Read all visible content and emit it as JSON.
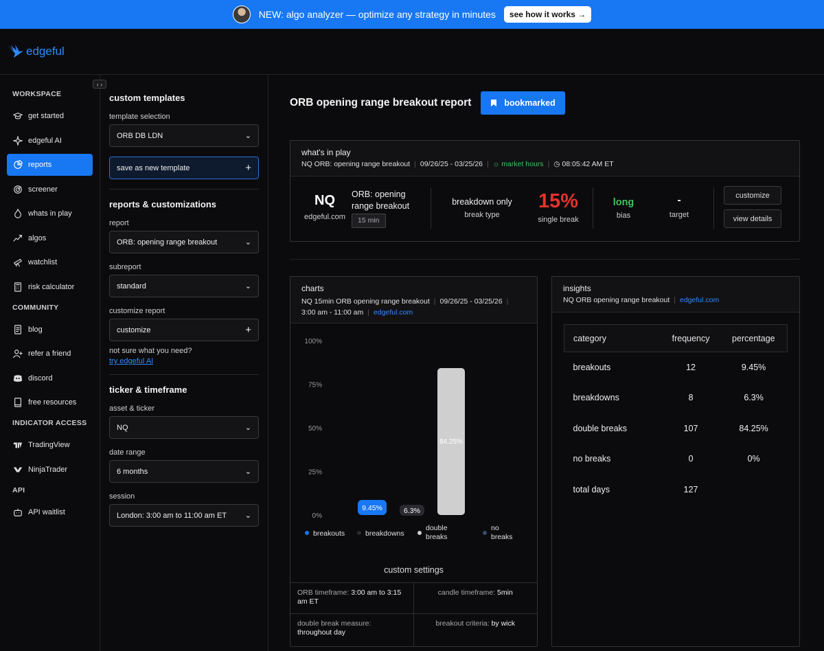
{
  "banner": {
    "text": "NEW: algo analyzer — optimize any strategy in minutes",
    "button": "see how it works →"
  },
  "brand": {
    "name": "edgeful"
  },
  "sidebar": {
    "workspace_title": "WORKSPACE",
    "workspace": [
      {
        "label": "get started",
        "icon": "graduation-cap-icon"
      },
      {
        "label": "edgeful AI",
        "icon": "sparkle-icon"
      },
      {
        "label": "reports",
        "icon": "chart-pie-icon",
        "active": true
      },
      {
        "label": "screener",
        "icon": "radar-icon"
      },
      {
        "label": "whats in play",
        "icon": "flame-icon"
      },
      {
        "label": "algos",
        "icon": "trend-icon"
      },
      {
        "label": "watchlist",
        "icon": "telescope-icon"
      },
      {
        "label": "risk calculator",
        "icon": "calculator-icon"
      }
    ],
    "community_title": "COMMUNITY",
    "community": [
      {
        "label": "blog",
        "icon": "blog-icon"
      },
      {
        "label": "refer a friend",
        "icon": "user-plus-icon"
      },
      {
        "label": "discord",
        "icon": "discord-icon"
      },
      {
        "label": "free resources",
        "icon": "book-icon"
      }
    ],
    "indicator_title": "INDICATOR ACCESS",
    "indicator": [
      {
        "label": "TradingView",
        "icon": "tradingview-icon"
      },
      {
        "label": "NinjaTrader",
        "icon": "ninjatrader-icon"
      }
    ],
    "api_title": "API",
    "api": [
      {
        "label": "API waitlist",
        "icon": "robot-icon"
      }
    ]
  },
  "panel": {
    "custom_templates": "custom templates",
    "template_selection_label": "template selection",
    "template_selection": "ORB DB LDN",
    "save_template": "save as new template",
    "reports_title": "reports & customizations",
    "report_label": "report",
    "report": "ORB: opening range breakout",
    "subreport_label": "subreport",
    "subreport": "standard",
    "customize_label": "customize report",
    "customize": "customize",
    "help_text": "not sure what you need?",
    "help_link": "try edgeful AI",
    "ticker_title": "ticker & timeframe",
    "asset_label": "asset & ticker",
    "asset": "NQ",
    "date_label": "date range",
    "date": "6 months",
    "session_label": "session",
    "session": "London: 3:00 am to 11:00 am ET"
  },
  "main": {
    "title": "ORB opening range breakout report",
    "bookmark": "bookmarked",
    "play": {
      "title": "what's in play",
      "subtitle": "NQ ORB: opening range breakout",
      "dates": "09/26/25 - 03/25/26",
      "market": "market hours",
      "time": "08:05:42 AM ET",
      "ticker": "NQ",
      "site": "edgeful.com",
      "orb_line1": "ORB: opening",
      "orb_line2": "range breakout",
      "orb_tf": "15 min",
      "break_type_value": "breakdown only",
      "break_type_label": "break type",
      "pct_value": "15%",
      "pct_label": "single break",
      "bias_value": "long",
      "bias_label": "bias",
      "target_value": "-",
      "target_label": "target",
      "customize_btn": "customize",
      "details_btn": "view details"
    },
    "charts": {
      "title": "charts",
      "subtitle": "NQ 15min ORB opening range breakout",
      "dates": "09/26/25 - 03/25/26",
      "session": "3:00 am - 11:00 am",
      "site": "edgeful.com",
      "custom_settings": "custom settings",
      "orb_tf_label": "ORB timeframe:",
      "orb_tf_value": "3:00 am to 3:15 am ET",
      "candle_tf_label": "candle timeframe:",
      "candle_tf_value": "5min",
      "db_measure_label": "double break measure:",
      "db_measure_value": "throughout day",
      "criteria_label": "breakout criteria:",
      "criteria_value": "by wick"
    },
    "insights": {
      "title": "insights",
      "subtitle": "NQ ORB opening range breakout",
      "site": "edgeful.com",
      "headers": [
        "category",
        "frequency",
        "percentage"
      ],
      "rows": [
        [
          "breakouts",
          "12",
          "9.45%"
        ],
        [
          "breakdowns",
          "8",
          "6.3%"
        ],
        [
          "double breaks",
          "107",
          "84.25%"
        ],
        [
          "no breaks",
          "0",
          "0%"
        ],
        [
          "total days",
          "127",
          ""
        ]
      ]
    }
  },
  "chart_data": {
    "type": "bar",
    "categories": [
      "breakouts",
      "breakdowns",
      "double breaks",
      "no breaks"
    ],
    "values": [
      9.45,
      6.3,
      84.25,
      0
    ],
    "data_labels": [
      "9.45%",
      "6.3%",
      "84.25%",
      ""
    ],
    "yticks": [
      "100%",
      "75%",
      "50%",
      "25%",
      "0%"
    ],
    "ylim": [
      0,
      100
    ],
    "legend": [
      "breakouts",
      "breakdowns",
      "double breaks",
      "no breaks"
    ],
    "legend_colors": [
      "#1877f2",
      "#2a2a30",
      "#cfcfcf",
      "#3a4a6a"
    ],
    "bar_colors": [
      "#1877f2",
      "#2a2a30",
      "#cfcfcf",
      "#3a4a6a"
    ]
  }
}
